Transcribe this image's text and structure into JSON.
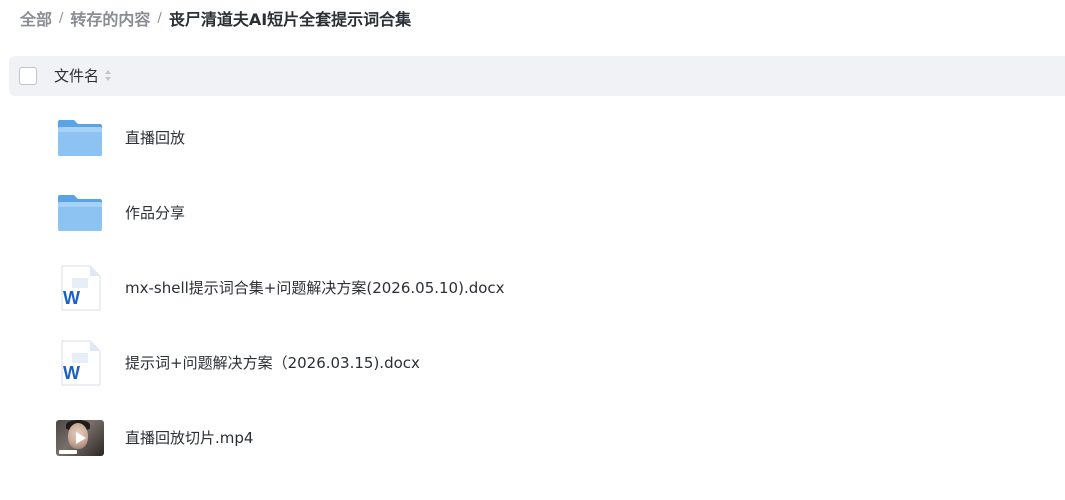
{
  "breadcrumb": {
    "items": [
      "全部",
      "转存的内容",
      "丧尸清道夫AI短片全套提示词合集"
    ],
    "separator": "/"
  },
  "table": {
    "header": {
      "name_column": "文件名"
    },
    "rows": [
      {
        "name": "直播回放",
        "type": "folder",
        "icon": "folder-icon"
      },
      {
        "name": "作品分享",
        "type": "folder",
        "icon": "folder-icon"
      },
      {
        "name": "mx-shell提示词合集+问题解决方案(2026.05.10).docx",
        "type": "docx",
        "icon": "word-document-icon"
      },
      {
        "name": "提示词+问题解决方案（2026.03.15).docx",
        "type": "docx",
        "icon": "word-document-icon"
      },
      {
        "name": "直播回放切片.mp4",
        "type": "video",
        "icon": "video-thumbnail"
      }
    ]
  },
  "colors": {
    "folder": "#7db9ef",
    "word_blue": "#1e5fc4",
    "header_bg": "#f0f2f5",
    "breadcrumb_muted": "#8a8d94",
    "text": "#2b2f36"
  }
}
